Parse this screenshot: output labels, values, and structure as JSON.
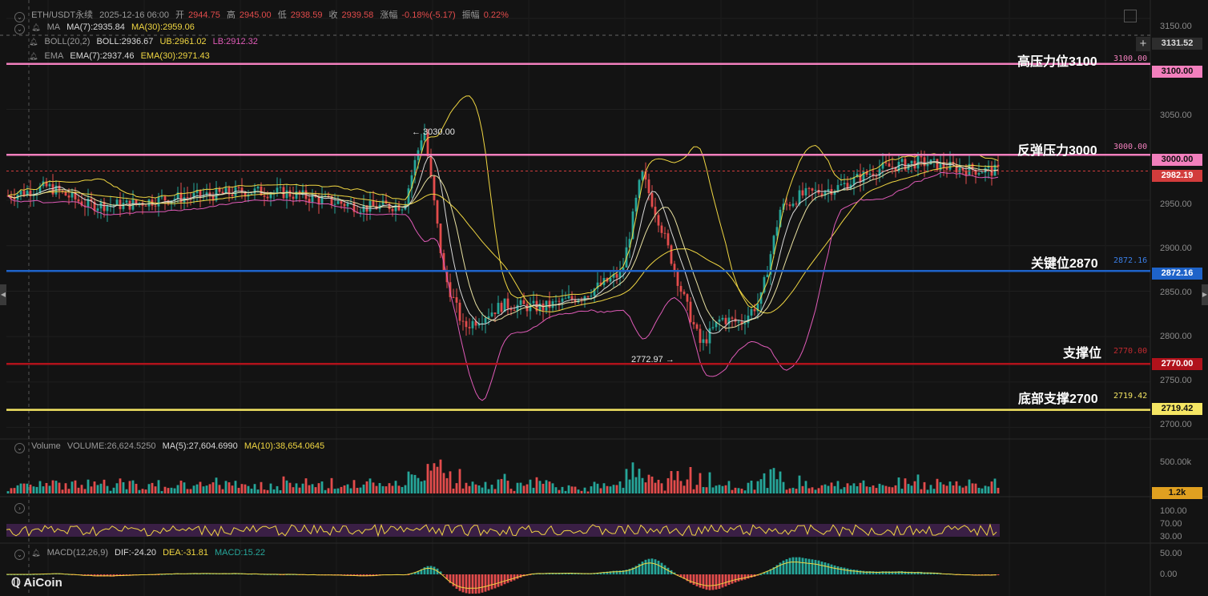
{
  "header": {
    "symbol": "ETH/USDT永续",
    "date": "2025-12-16 06:00",
    "open_label": "开",
    "open": "2944.75",
    "high_label": "高",
    "high": "2945.00",
    "low_label": "低",
    "low": "2938.59",
    "close_label": "收",
    "close": "2939.58",
    "change_label": "涨幅",
    "change": "-0.18%(-5.17)",
    "amp_label": "振幅",
    "amp": "0.22%"
  },
  "indicators": {
    "ma": {
      "name": "MA",
      "ma7": "MA(7):2935.84",
      "ma30": "MA(30):2959.06"
    },
    "boll": {
      "name": "BOLL(20,2)",
      "boll": "BOLL:2936.67",
      "ub": "UB:2961.02",
      "lb": "LB:2912.32"
    },
    "ema": {
      "name": "EMA",
      "ema7": "EMA(7):2937.46",
      "ema30": "EMA(30):2971.43"
    },
    "volume": {
      "name": "Volume",
      "vol": "VOLUME:26,624.5250",
      "ma5": "MA(5):27,604.6990",
      "ma10": "MA(10):38,654.0645"
    },
    "macd": {
      "name": "MACD(12,26,9)",
      "dif": "DIF:-24.20",
      "dea": "DEA:-31.81",
      "macd": "MACD:15.22"
    }
  },
  "levels": [
    {
      "label": "高压力位3100",
      "value": "3100.00",
      "tag": "3100.00",
      "price": 3100,
      "color": "#f27fbd"
    },
    {
      "label": "反弹压力3000",
      "value": "3000.00",
      "tag": "3000.00",
      "price": 3000,
      "color": "#f27fbd"
    },
    {
      "label": "关键位2870",
      "value": "2872.16",
      "tag": "2872.16",
      "price": 2872.16,
      "color": "#1e63c9"
    },
    {
      "label": "支撑位",
      "value": "2770.00",
      "tag": "2770.00",
      "price": 2770,
      "color": "#b0121b"
    },
    {
      "label": "底部支撑2700",
      "value": "2719.42",
      "tag": "2719.42",
      "price": 2719.42,
      "color": "#f5e663"
    }
  ],
  "price_tags": {
    "crosshair": "3131.52",
    "current": "2982.19",
    "volume_current": "1.2k"
  },
  "annotations": {
    "high_peak": "← 3030.00",
    "low_trough": "2772.97 →"
  },
  "y_axis": {
    "price_ticks": [
      "3150.00",
      "3050.00",
      "2950.00",
      "2900.00",
      "2850.00",
      "2800.00",
      "2750.00",
      "2700.00"
    ],
    "volume_ticks": [
      "500.00k"
    ],
    "rsi_ticks": [
      "100.00",
      "70.00",
      "30.00"
    ],
    "macd_ticks": [
      "50.00",
      "0.00"
    ]
  },
  "logo": "AiCoin",
  "colors": {
    "up": "#26a69a",
    "down": "#e34c4c",
    "ma7": "#d9d9d9",
    "ma30": "#f0d642",
    "boll_lb": "#e05bb8",
    "background": "#131313"
  },
  "chart_data": {
    "type": "candlestick",
    "symbol": "ETH/USDT永续",
    "ylim": [
      2690,
      3165
    ],
    "price_path": [
      [
        0,
        2955
      ],
      [
        0.04,
        2965
      ],
      [
        0.08,
        2945
      ],
      [
        0.12,
        2945
      ],
      [
        0.16,
        2952
      ],
      [
        0.2,
        2955
      ],
      [
        0.24,
        2960
      ],
      [
        0.28,
        2958
      ],
      [
        0.32,
        2950
      ],
      [
        0.36,
        2942
      ],
      [
        0.4,
        2945
      ],
      [
        0.42,
        3030
      ],
      [
        0.44,
        2870
      ],
      [
        0.46,
        2810
      ],
      [
        0.5,
        2835
      ],
      [
        0.54,
        2832
      ],
      [
        0.58,
        2845
      ],
      [
        0.62,
        2870
      ],
      [
        0.64,
        2980
      ],
      [
        0.66,
        2920
      ],
      [
        0.68,
        2850
      ],
      [
        0.7,
        2790
      ],
      [
        0.72,
        2820
      ],
      [
        0.74,
        2815
      ],
      [
        0.76,
        2840
      ],
      [
        0.78,
        2940
      ],
      [
        0.8,
        2955
      ],
      [
        0.84,
        2965
      ],
      [
        0.88,
        2985
      ],
      [
        0.92,
        2992
      ],
      [
        0.96,
        2985
      ],
      [
        1,
        2982
      ]
    ],
    "high_marker": {
      "price": 3030.0
    },
    "low_marker": {
      "price": 2772.97
    },
    "horizontal_levels": [
      3100.0,
      3000.0,
      2872.16,
      2770.0,
      2719.42
    ],
    "current_price": 2982.19
  }
}
